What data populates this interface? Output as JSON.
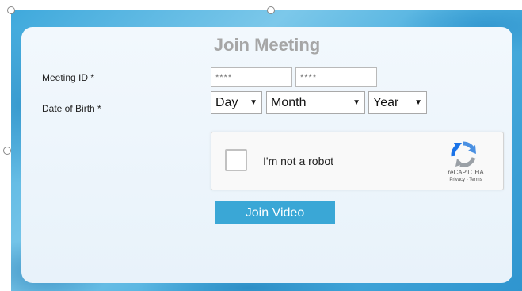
{
  "form": {
    "title": "Join Meeting",
    "meeting_id_label": "Meeting ID *",
    "meeting_id_part1_placeholder": "****",
    "meeting_id_part2_placeholder": "****",
    "dob_label": "Date of Birth *",
    "day_select": "Day",
    "month_select": "Month",
    "year_select": "Year",
    "submit_label": "Join Video"
  },
  "captcha": {
    "checkbox_label": "I'm not a robot",
    "brand": "reCAPTCHA",
    "links": "Privacy - Terms",
    "icon": "recaptcha-logo-icon"
  },
  "colors": {
    "button": "#3aa7d6",
    "title": "#a6a6a6",
    "panel": "#eef5fb"
  }
}
